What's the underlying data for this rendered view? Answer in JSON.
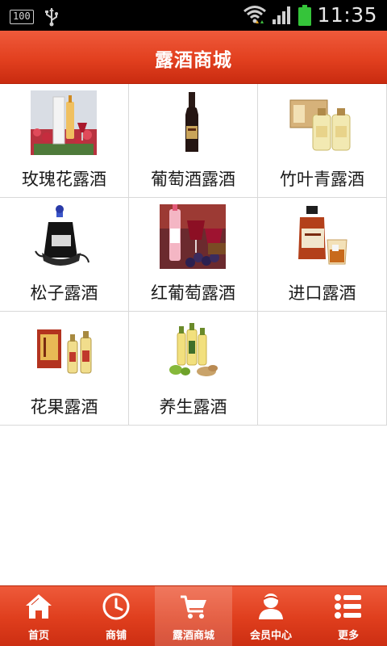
{
  "status_bar": {
    "battery_level_label": "100",
    "time": "11:35"
  },
  "header": {
    "title": "露酒商城"
  },
  "categories": [
    {
      "label": "玫瑰花露酒",
      "image": "rose-liqueur-photo"
    },
    {
      "label": "葡萄酒露酒",
      "image": "red-wine-bottle-photo"
    },
    {
      "label": "竹叶青露酒",
      "image": "bamboo-leaf-liqueur-photo"
    },
    {
      "label": "松子露酒",
      "image": "pine-nut-liqueur-photo"
    },
    {
      "label": "红葡萄露酒",
      "image": "red-grape-liqueur-photo"
    },
    {
      "label": "进口露酒",
      "image": "imported-liqueur-photo"
    },
    {
      "label": "花果露酒",
      "image": "flower-fruit-liqueur-photo"
    },
    {
      "label": "养生露酒",
      "image": "health-liqueur-photo"
    }
  ],
  "bottom_nav": {
    "items": [
      {
        "label": "首页",
        "icon": "home-icon",
        "active": false
      },
      {
        "label": "商铺",
        "icon": "clock-icon",
        "active": false
      },
      {
        "label": "露酒商城",
        "icon": "cart-icon",
        "active": true
      },
      {
        "label": "会员中心",
        "icon": "user-icon",
        "active": false
      },
      {
        "label": "更多",
        "icon": "list-icon",
        "active": false
      }
    ]
  },
  "colors": {
    "brand_red": "#e2401f",
    "status_bar": "#000000",
    "battery_green": "#35c43a"
  }
}
